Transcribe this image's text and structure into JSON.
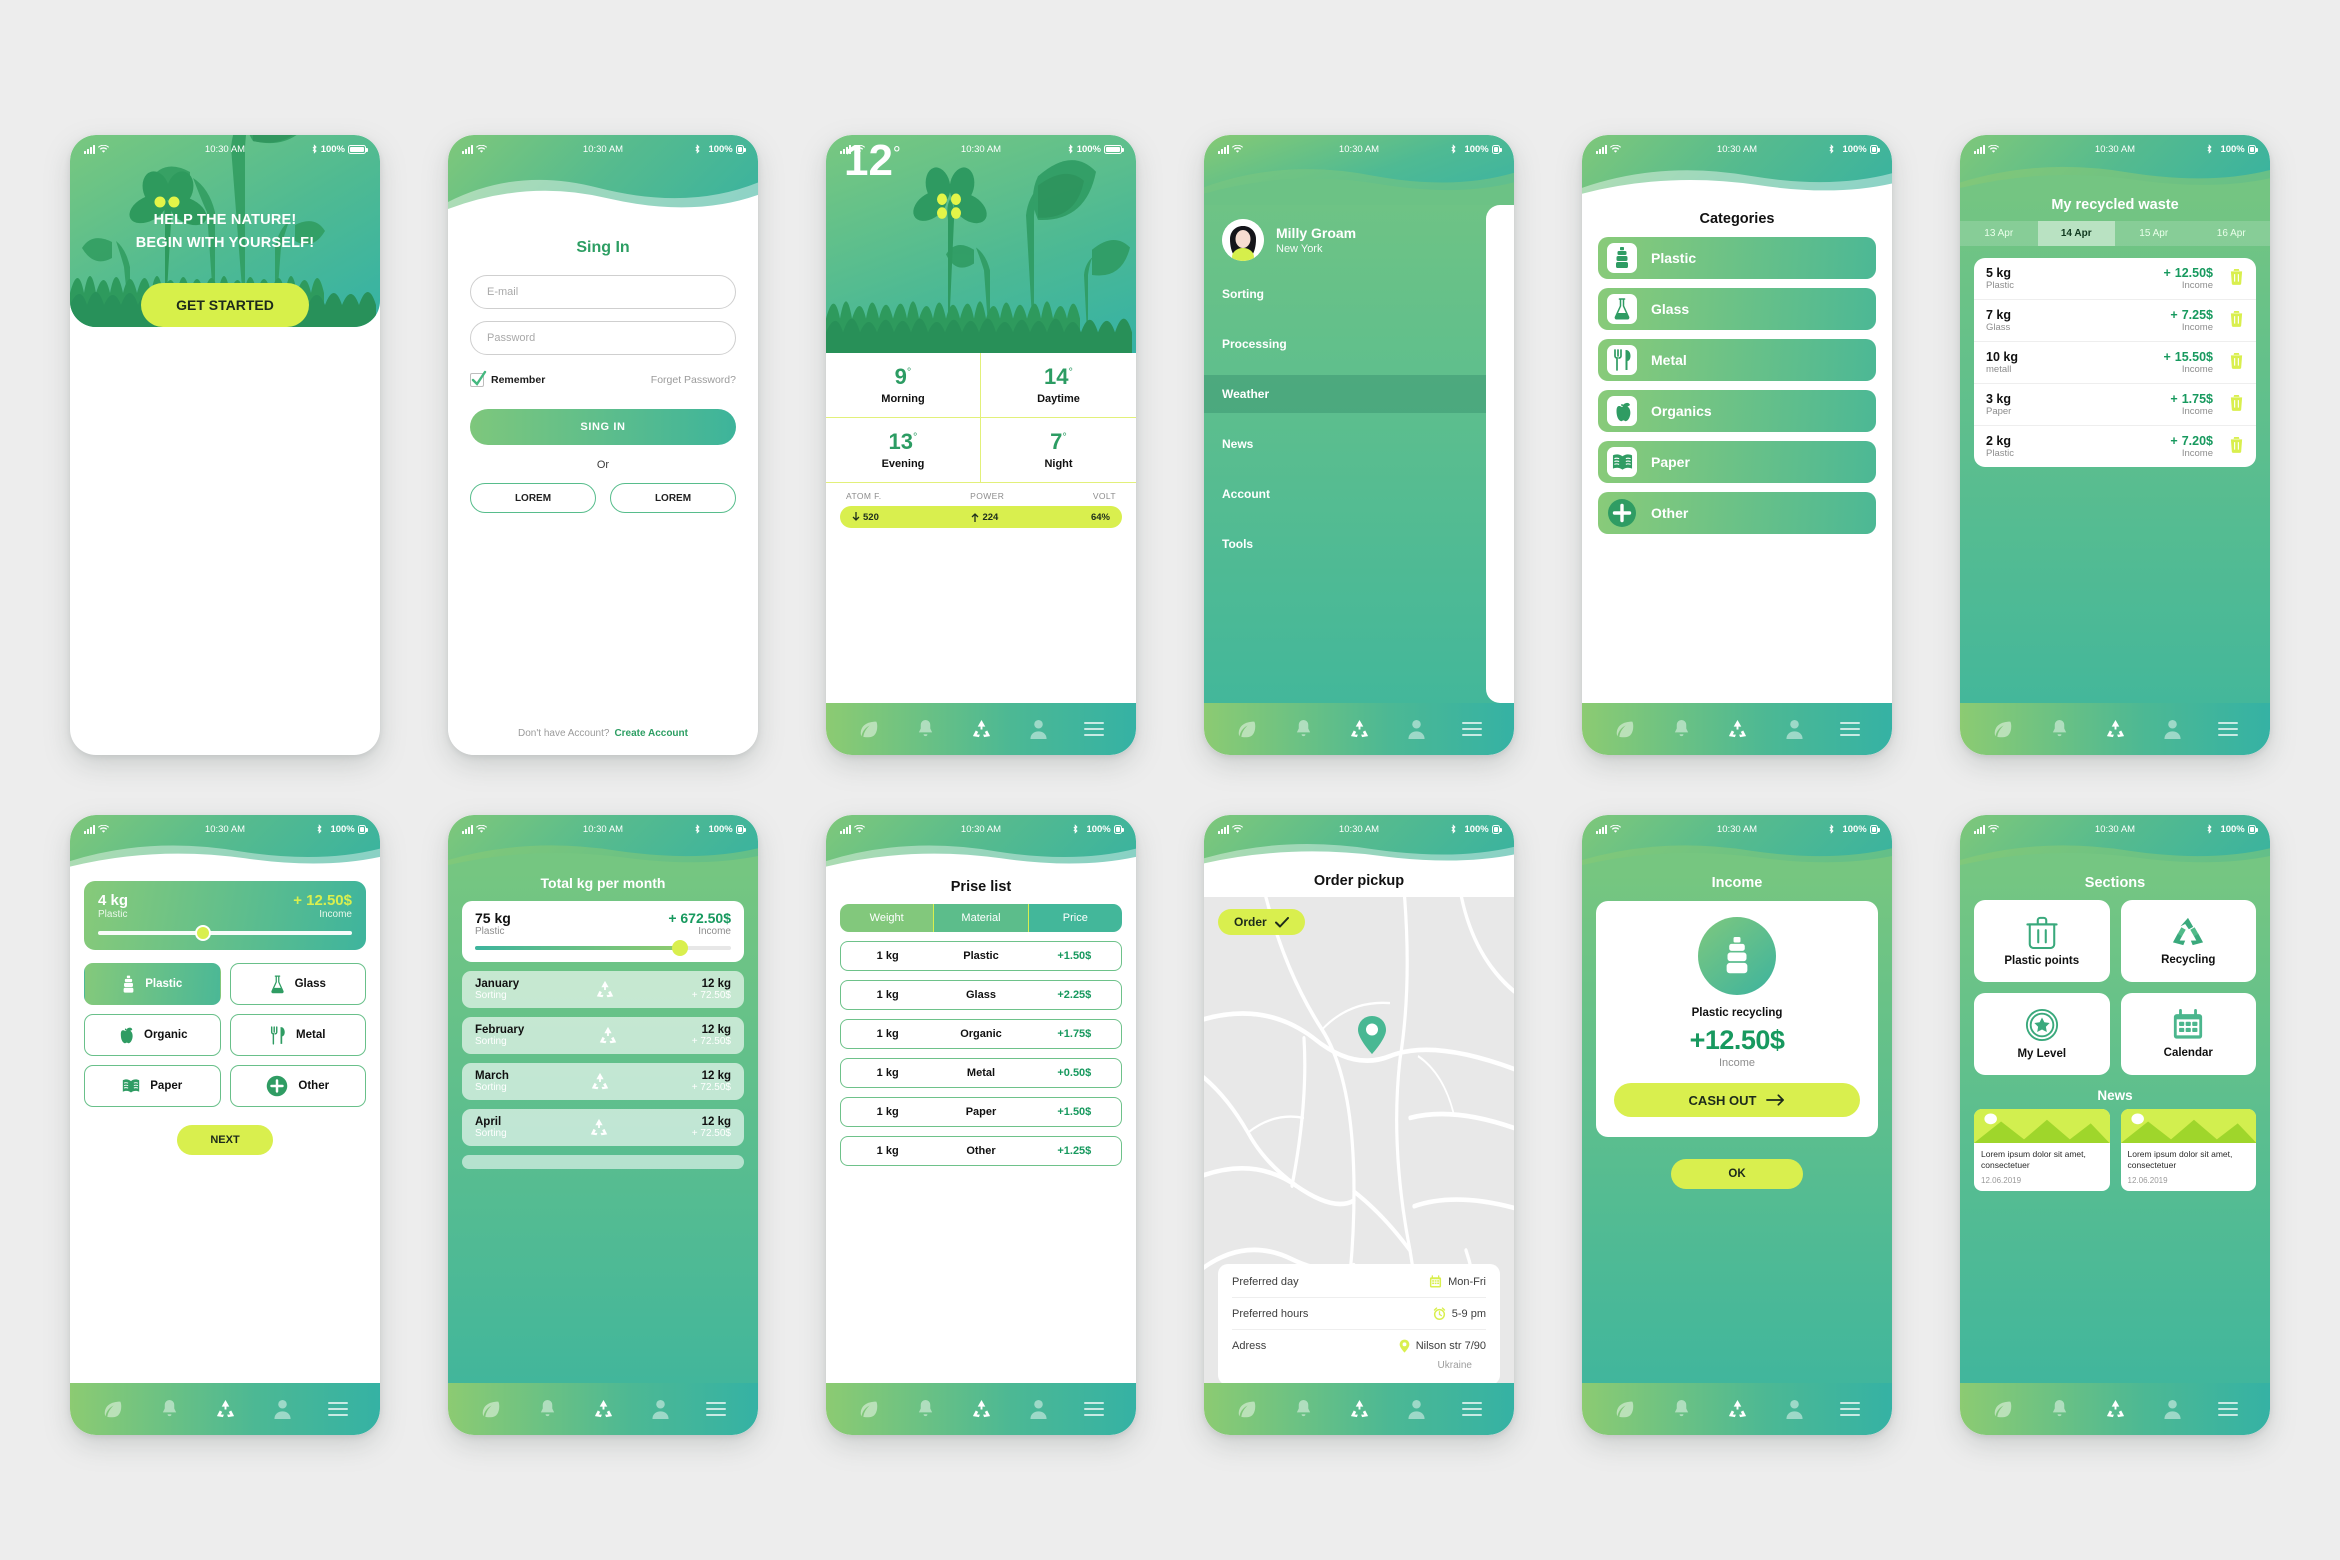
{
  "status_bar": {
    "time": "10:30 AM",
    "battery": "100%"
  },
  "nav": {
    "items": [
      "leaf-icon",
      "bell-icon",
      "recycle-icon",
      "user-icon",
      "menu-icon"
    ]
  },
  "colors": {
    "lime": "#d9ef4e",
    "green": "#17995e",
    "teal": "#3db49d",
    "light_green": "#82c87c"
  },
  "screens": {
    "onboarding": {
      "title_line1": "HELP THE NATURE!",
      "title_line2": "BEGIN WITH YOURSELF!",
      "cta": "GET STARTED"
    },
    "signin": {
      "title": "Sing In",
      "email_placeholder": "E-mail",
      "password_placeholder": "Password",
      "remember": "Remember",
      "forgot": "Forget Password?",
      "submit": "SING IN",
      "or": "Or",
      "social_left": "LOREM",
      "social_right": "LOREM",
      "footer_text": "Don't have Account?",
      "footer_link": "Create Account"
    },
    "weather": {
      "current_temp": "12",
      "degree": "°",
      "cells": [
        {
          "value": "9",
          "label": "Morning"
        },
        {
          "value": "14",
          "label": "Daytime"
        },
        {
          "value": "13",
          "label": "Evening"
        },
        {
          "value": "7",
          "label": "Night"
        }
      ],
      "stat_headers": [
        "ATOM F.",
        "POWER",
        "VOLT"
      ],
      "stat_values": [
        "520",
        "224",
        "64%"
      ]
    },
    "menu": {
      "name": "Milly Groam",
      "city": "New York",
      "items": [
        "Sorting",
        "Processing",
        "Weather",
        "News",
        "Account",
        "Tools"
      ],
      "active_index": 2
    },
    "categories": {
      "title": "Categories",
      "items": [
        {
          "label": "Plastic",
          "icon": "bottle-icon"
        },
        {
          "label": "Glass",
          "icon": "flask-icon"
        },
        {
          "label": "Metal",
          "icon": "cutlery-icon"
        },
        {
          "label": "Organics",
          "icon": "apple-icon"
        },
        {
          "label": "Paper",
          "icon": "book-icon"
        },
        {
          "label": "Other",
          "icon": "plus-circle-icon"
        }
      ]
    },
    "recycled_waste": {
      "title": "My recycled waste",
      "dates": [
        "13 Apr",
        "14 Apr",
        "15 Apr",
        "16 Apr"
      ],
      "active_date_index": 1,
      "rows": [
        {
          "kg": "5 kg",
          "material": "Plastic",
          "amount": "12.50$",
          "sign": "+",
          "label": "Income"
        },
        {
          "kg": "7 kg",
          "material": "Glass",
          "amount": "7.25$",
          "sign": "+",
          "label": "Income"
        },
        {
          "kg": "10 kg",
          "material": "metall",
          "amount": "15.50$",
          "sign": "+",
          "label": "Income"
        },
        {
          "kg": "3 kg",
          "material": "Paper",
          "amount": "1.75$",
          "sign": "+",
          "label": "Income"
        },
        {
          "kg": "2 kg",
          "material": "Plastic",
          "amount": "7.20$",
          "sign": "+",
          "label": "Income"
        }
      ]
    },
    "sorting": {
      "kg": "4 kg",
      "material": "Plastic",
      "amount": "+  12.50$",
      "income_label": "Income",
      "slider_percent": 42,
      "tiles": [
        {
          "label": "Plastic",
          "icon": "bottle-icon",
          "selected": true
        },
        {
          "label": "Glass",
          "icon": "flask-icon",
          "selected": false
        },
        {
          "label": "Organic",
          "icon": "apple-icon",
          "selected": false
        },
        {
          "label": "Metal",
          "icon": "cutlery-icon",
          "selected": false
        },
        {
          "label": "Paper",
          "icon": "book-icon",
          "selected": false
        },
        {
          "label": "Other",
          "icon": "plus-circle-icon",
          "selected": false
        }
      ],
      "next": "NEXT"
    },
    "total_month": {
      "title": "Total kg per month",
      "total_kg": "75 kg",
      "total_material": "Plastic",
      "total_amount": "+ 672.50$",
      "income_label": "Income",
      "slider_percent": 80,
      "months": [
        {
          "month": "January",
          "type": "Sorting",
          "kg": "12 kg",
          "amount": "+ 72.50$"
        },
        {
          "month": "February",
          "type": "Sorting",
          "kg": "12 kg",
          "amount": "+ 72.50$"
        },
        {
          "month": "March",
          "type": "Sorting",
          "kg": "12 kg",
          "amount": "+ 72.50$"
        },
        {
          "month": "April",
          "type": "Sorting",
          "kg": "12 kg",
          "amount": "+ 72.50$"
        }
      ]
    },
    "price_list": {
      "title": "Prise list",
      "headers": [
        "Weight",
        "Material",
        "Price"
      ],
      "rows": [
        {
          "weight": "1 kg",
          "material": "Plastic",
          "price": "+1.50$"
        },
        {
          "weight": "1 kg",
          "material": "Glass",
          "price": "+2.25$"
        },
        {
          "weight": "1 kg",
          "material": "Organic",
          "price": "+1.75$"
        },
        {
          "weight": "1 kg",
          "material": "Metal",
          "price": "+0.50$"
        },
        {
          "weight": "1 kg",
          "material": "Paper",
          "price": "+1.50$"
        },
        {
          "weight": "1 kg",
          "material": "Other",
          "price": "+1.25$"
        }
      ]
    },
    "order_pickup": {
      "title": "Order pickup",
      "order_button": "Order",
      "rows": [
        {
          "label": "Preferred day",
          "value": "Mon-Fri",
          "icon": "calendar-icon"
        },
        {
          "label": "Preferred hours",
          "value": "5-9 pm",
          "icon": "alarm-icon"
        },
        {
          "label": "Adress",
          "value": "Nilson str 7/90",
          "icon": "pin-icon"
        }
      ],
      "country": "Ukraine"
    },
    "income": {
      "title": "Income",
      "card_name": "Plastic recycling",
      "amount": "+12.50$",
      "sub": "Income",
      "cash_out": "CASH OUT",
      "ok": "OK"
    },
    "sections": {
      "title": "Sections",
      "boxes": [
        {
          "label": "Plastic points",
          "icon": "trash-icon"
        },
        {
          "label": "Recycling",
          "icon": "recycle-icon"
        },
        {
          "label": "My Level",
          "icon": "star-badge-icon"
        },
        {
          "label": "Calendar",
          "icon": "calendar-icon"
        }
      ],
      "news_title": "News",
      "news": [
        {
          "text": "Lorem ipsum dolor sit amet, consectetuer",
          "date": "12.06.2019"
        },
        {
          "text": "Lorem ipsum dolor sit amet, consectetuer",
          "date": "12.06.2019"
        }
      ]
    }
  }
}
